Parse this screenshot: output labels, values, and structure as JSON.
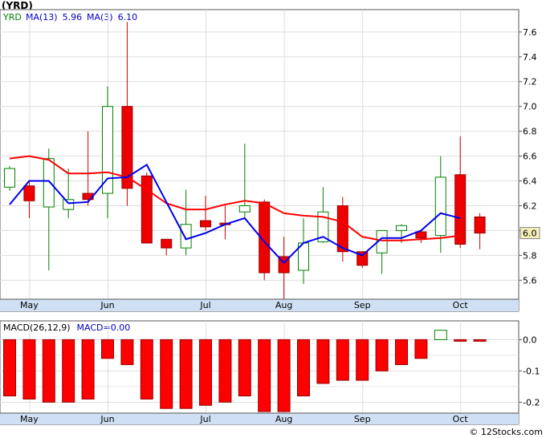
{
  "chart_data": [
    {
      "type": "candlestick",
      "title": "(YRD)",
      "legend": [
        {
          "label": "YRD",
          "color": "#008000"
        },
        {
          "label": "MA(13)",
          "value": "5.96",
          "color": "#0000cc"
        },
        {
          "label": "MA(3)",
          "value": "6.10",
          "color": "#0000cc"
        }
      ],
      "ylim": [
        5.35,
        7.78
      ],
      "yticks": [
        5.6,
        5.8,
        6.0,
        6.2,
        6.4,
        6.6,
        6.8,
        7.0,
        7.2,
        7.4,
        7.6
      ],
      "ytick_labels": [
        "5.6",
        "5.8",
        "",
        "6.2",
        "6.4",
        "6.6",
        "6.8",
        "7.0",
        "7.2",
        "7.4",
        "7.6"
      ],
      "last_price_label": "6.0",
      "x_labels": [
        {
          "label": "May",
          "index": 1
        },
        {
          "label": "Jun",
          "index": 5
        },
        {
          "label": "Jul",
          "index": 10
        },
        {
          "label": "Aug",
          "index": 14
        },
        {
          "label": "Sep",
          "index": 18
        },
        {
          "label": "Oct",
          "index": 23
        }
      ],
      "candles": [
        {
          "o": 6.35,
          "h": 6.52,
          "l": 6.32,
          "c": 6.5
        },
        {
          "o": 6.36,
          "h": 6.4,
          "l": 6.1,
          "c": 6.24
        },
        {
          "o": 6.19,
          "h": 6.66,
          "l": 5.68,
          "c": 6.58
        },
        {
          "o": 6.17,
          "h": 6.5,
          "l": 6.1,
          "c": 6.25
        },
        {
          "o": 6.3,
          "h": 6.8,
          "l": 6.2,
          "c": 6.25
        },
        {
          "o": 6.3,
          "h": 7.16,
          "l": 6.1,
          "c": 7.0
        },
        {
          "o": 7.0,
          "h": 7.68,
          "l": 6.2,
          "c": 6.34
        },
        {
          "o": 6.44,
          "h": 6.47,
          "l": 5.9,
          "c": 5.9
        },
        {
          "o": 5.93,
          "h": 5.93,
          "l": 5.8,
          "c": 5.86
        },
        {
          "o": 5.86,
          "h": 6.33,
          "l": 5.8,
          "c": 6.05
        },
        {
          "o": 6.08,
          "h": 6.28,
          "l": 6.0,
          "c": 6.03
        },
        {
          "o": 6.06,
          "h": 6.2,
          "l": 5.93,
          "c": 6.05
        },
        {
          "o": 6.15,
          "h": 6.7,
          "l": 6.1,
          "c": 6.2
        },
        {
          "o": 6.23,
          "h": 6.25,
          "l": 5.6,
          "c": 5.66
        },
        {
          "o": 5.79,
          "h": 5.95,
          "l": 5.42,
          "c": 5.66
        },
        {
          "o": 5.68,
          "h": 6.1,
          "l": 5.57,
          "c": 5.9
        },
        {
          "o": 5.91,
          "h": 6.35,
          "l": 5.9,
          "c": 6.15
        },
        {
          "o": 6.2,
          "h": 6.27,
          "l": 5.75,
          "c": 5.83
        },
        {
          "o": 5.83,
          "h": 5.83,
          "l": 5.7,
          "c": 5.72
        },
        {
          "o": 5.82,
          "h": 6.0,
          "l": 5.65,
          "c": 6.0
        },
        {
          "o": 6.0,
          "h": 6.05,
          "l": 5.9,
          "c": 6.04
        },
        {
          "o": 5.99,
          "h": 6.0,
          "l": 5.9,
          "c": 5.94
        },
        {
          "o": 5.96,
          "h": 6.6,
          "l": 5.82,
          "c": 6.43
        },
        {
          "o": 6.45,
          "h": 6.76,
          "l": 5.86,
          "c": 5.89
        },
        {
          "o": 6.11,
          "h": 6.14,
          "l": 5.85,
          "c": 5.98
        }
      ],
      "ma_red": [
        6.58,
        6.6,
        6.57,
        6.46,
        6.46,
        6.47,
        6.43,
        6.33,
        6.22,
        6.17,
        6.17,
        6.21,
        6.24,
        6.22,
        6.14,
        6.12,
        6.11,
        6.07,
        5.95,
        5.92,
        5.92,
        5.93,
        5.94,
        5.96
      ],
      "ma_red_start": 0,
      "ma_blue": [
        6.21,
        6.4,
        6.4,
        6.22,
        6.23,
        6.42,
        6.43,
        6.53,
        6.23,
        5.93,
        5.98,
        6.05,
        6.1,
        5.91,
        5.74,
        5.9,
        5.95,
        5.86,
        5.8,
        5.94,
        5.94,
        6.0,
        6.14,
        6.1
      ],
      "ma_blue_start": 0
    },
    {
      "type": "bar",
      "title": "MACD",
      "legend": [
        {
          "label": "MACD(26,12,9)",
          "color": "#000000"
        },
        {
          "label": "MACD=0.00",
          "color": "#0000cc"
        }
      ],
      "ylim": [
        -0.235,
        0.06
      ],
      "yticks": [
        0.0,
        -0.1,
        -0.2
      ],
      "ytick_labels": [
        "0.0",
        "-0.1",
        "-0.2"
      ],
      "values": [
        -0.18,
        -0.19,
        -0.2,
        -0.2,
        -0.19,
        -0.06,
        -0.08,
        -0.19,
        -0.22,
        -0.22,
        -0.21,
        -0.2,
        -0.18,
        -0.23,
        -0.23,
        -0.18,
        -0.14,
        -0.13,
        -0.13,
        -0.1,
        -0.08,
        -0.06,
        0.03,
        -0.01,
        -0.01
      ],
      "positive_color": "#008000",
      "negative_color": "#ff0000",
      "x_labels": [
        "May",
        "Jun",
        "Jul",
        "Aug",
        "Sep",
        "Oct"
      ],
      "watermark": "© 12Stocks.com"
    }
  ]
}
